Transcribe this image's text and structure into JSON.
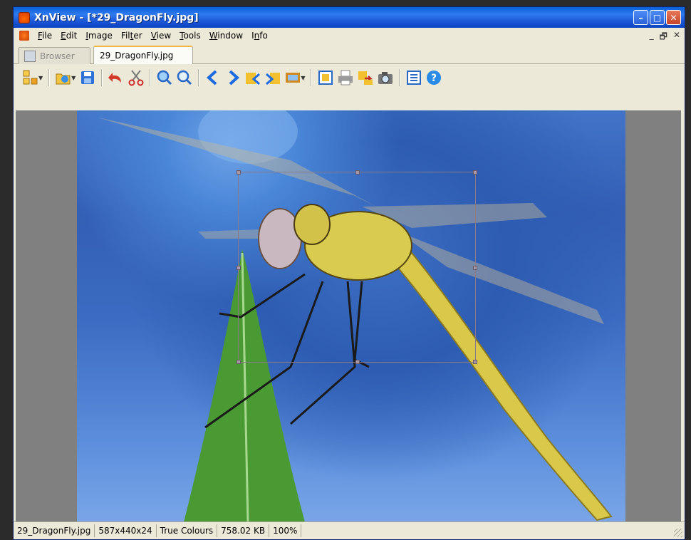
{
  "window": {
    "title": "XnView - [*29_DragonFly.jpg]",
    "controls": {
      "minimize": "–",
      "maximize": "□",
      "close": "✕"
    }
  },
  "menu": {
    "items": [
      {
        "label": "File",
        "underline": "F"
      },
      {
        "label": "Edit",
        "underline": "E"
      },
      {
        "label": "Image",
        "underline": "I"
      },
      {
        "label": "Filter",
        "underline": "t"
      },
      {
        "label": "View",
        "underline": "V"
      },
      {
        "label": "Tools",
        "underline": "T"
      },
      {
        "label": "Window",
        "underline": "W"
      },
      {
        "label": "Info",
        "underline": "n"
      }
    ],
    "mdi_controls": {
      "minimize": "_",
      "restore": "🗗",
      "close": "✕"
    }
  },
  "tabs": [
    {
      "label": "Browser",
      "active": false
    },
    {
      "label": "29_DragonFly.jpg",
      "active": true
    }
  ],
  "toolbar": {
    "tools": [
      "browse-icon",
      "open-icon",
      "save-icon",
      "undo-icon",
      "cut-icon",
      "zoom-in-icon",
      "zoom-out-icon",
      "previous-icon",
      "next-icon",
      "first-icon",
      "last-icon",
      "slideshow-icon",
      "fullscreen-icon",
      "print-icon",
      "convert-icon",
      "capture-icon",
      "properties-icon",
      "help-icon"
    ]
  },
  "image": {
    "subject": "dragonfly on a leaf",
    "colors": {
      "sky": "#3b6bc2",
      "leaf": "#3f8a2f",
      "body": "#d8c84a"
    }
  },
  "statusbar": {
    "filename": "29_DragonFly.jpg",
    "dimensions": "587x440x24",
    "color_mode": "True Colours",
    "file_size": "758.02 KB",
    "zoom": "100%"
  }
}
